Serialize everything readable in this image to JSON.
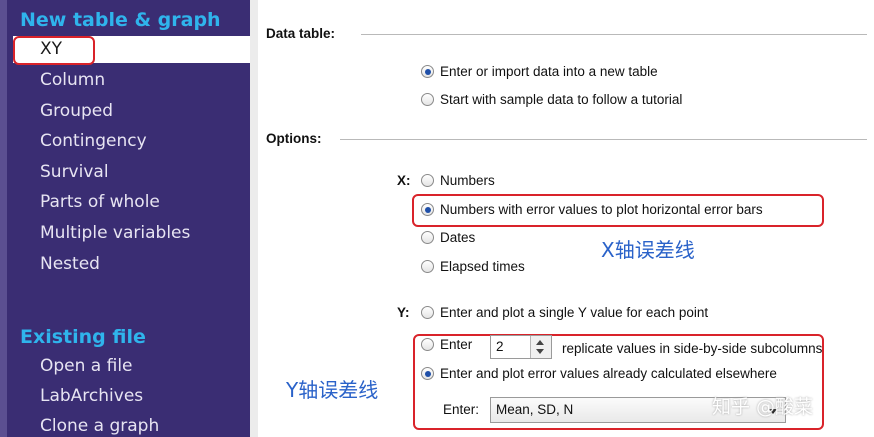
{
  "sidebar": {
    "new_heading": "New table & graph",
    "items": [
      "XY",
      "Column",
      "Grouped",
      "Contingency",
      "Survival",
      "Parts of whole",
      "Multiple variables",
      "Nested"
    ],
    "selected_index": 0,
    "existing_heading": "Existing file",
    "existing_items": [
      "Open a file",
      "LabArchives",
      "Clone a graph"
    ]
  },
  "data_table": {
    "title": "Data table:",
    "options": [
      "Enter or import data into a new table",
      "Start with sample data to follow a tutorial"
    ],
    "selected": 0
  },
  "options": {
    "title": "Options:",
    "x": {
      "label": "X:",
      "choices": [
        "Numbers",
        "Numbers with error values to plot horizontal error bars",
        "Dates",
        "Elapsed times"
      ],
      "selected": 1
    },
    "y": {
      "label": "Y:",
      "single": "Enter and plot a single Y value for each point",
      "enter_label": "Enter",
      "replicates_value": "2",
      "replicates_suffix": "replicate values in side-by-side subcolumns",
      "error_values": "Enter and plot error values already calculated elsewhere",
      "selected": "error_values",
      "enter_select_label": "Enter:",
      "enter_select_value": "Mean, SD, N"
    }
  },
  "annotations": {
    "x_error": "X轴误差线",
    "y_error": "Y轴误差线",
    "watermark": "知乎 @酸菜",
    "highlight_color": "#d9232a",
    "annotation_color": "#2a62c9"
  }
}
